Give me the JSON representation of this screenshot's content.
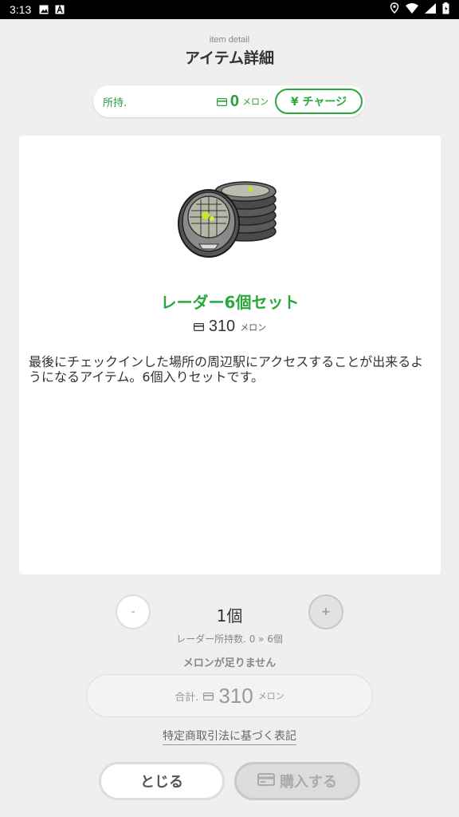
{
  "status_bar": {
    "time": "3:13"
  },
  "header": {
    "subtitle": "item detail",
    "title": "アイテム詳細"
  },
  "balance": {
    "label": "所持.",
    "amount": "0",
    "unit": "メロン",
    "charge_label": "¥ チャージ"
  },
  "item": {
    "name": "レーダー6個セット",
    "price": "310",
    "price_unit": "メロン",
    "description": "最後にチェックインした場所の周辺駅にアクセスすることが出来るようになるアイテム。6個入りセットです。"
  },
  "quantity": {
    "minus": "-",
    "plus": "+",
    "value": "1個",
    "owned_text": "レーダー所持数. 0 » 6個",
    "warning": "メロンが足りません"
  },
  "total": {
    "label": "合計.",
    "amount": "310",
    "unit": "メロン"
  },
  "law_link": "特定商取引法に基づく表記",
  "buttons": {
    "close": "とじる",
    "buy": "購入する"
  },
  "colors": {
    "accent_green": "#2aa83c",
    "background": "#efefef"
  },
  "icons": [
    "image-icon",
    "a-icon",
    "location-icon",
    "wifi-icon",
    "signal-icon",
    "battery-icon",
    "card-icon"
  ]
}
